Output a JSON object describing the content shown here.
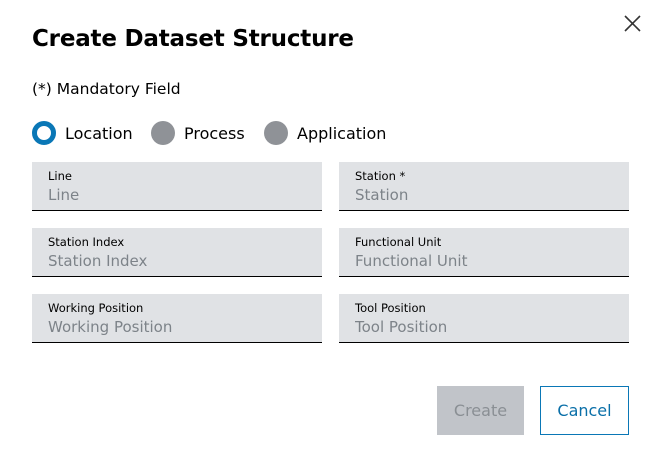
{
  "dialog": {
    "title": "Create Dataset Structure",
    "mandatory_note": "(*) Mandatory Field",
    "close_icon": "close-icon"
  },
  "radio_options": [
    {
      "label": "Location",
      "checked": true
    },
    {
      "label": "Process",
      "checked": false
    },
    {
      "label": "Application",
      "checked": false
    }
  ],
  "fields": {
    "line": {
      "label": "Line",
      "placeholder": "Line",
      "value": ""
    },
    "station": {
      "label": "Station *",
      "placeholder": "Station",
      "value": ""
    },
    "station_index": {
      "label": "Station Index",
      "placeholder": "Station Index",
      "value": ""
    },
    "functional_unit": {
      "label": "Functional Unit",
      "placeholder": "Functional Unit",
      "value": ""
    },
    "working_position": {
      "label": "Working Position",
      "placeholder": "Working Position",
      "value": ""
    },
    "tool_position": {
      "label": "Tool Position",
      "placeholder": "Tool Position",
      "value": ""
    }
  },
  "buttons": {
    "create_label": "Create",
    "create_disabled": true,
    "cancel_label": "Cancel"
  },
  "colors": {
    "accent": "#0a77b6",
    "field_background": "#e0e2e5",
    "radio_unchecked": "#8f9297",
    "disabled_button": "#c1c4c9"
  }
}
